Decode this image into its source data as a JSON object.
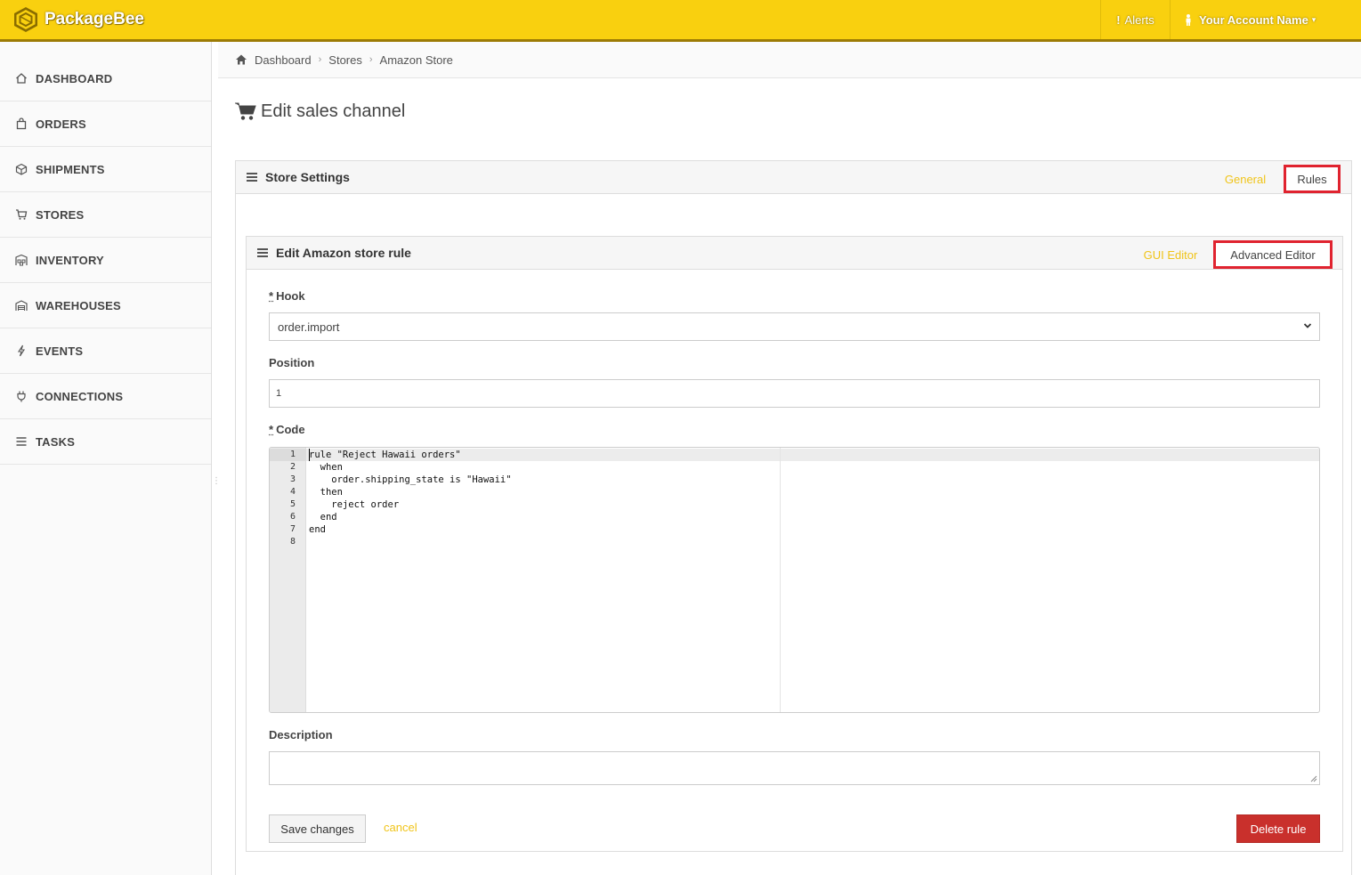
{
  "header": {
    "brand_name": "PackageBee",
    "alerts_label": "Alerts",
    "account_label": "Your Account Name"
  },
  "sidebar": {
    "items": [
      {
        "label": "DASHBOARD",
        "icon": "home-icon"
      },
      {
        "label": "ORDERS",
        "icon": "bag-icon"
      },
      {
        "label": "SHIPMENTS",
        "icon": "box-icon"
      },
      {
        "label": "STORES",
        "icon": "cart-icon"
      },
      {
        "label": "INVENTORY",
        "icon": "inventory-icon"
      },
      {
        "label": "WAREHOUSES",
        "icon": "warehouse-icon"
      },
      {
        "label": "EVENTS",
        "icon": "lightning-icon"
      },
      {
        "label": "CONNECTIONS",
        "icon": "plug-icon"
      },
      {
        "label": "TASKS",
        "icon": "list-icon"
      }
    ]
  },
  "breadcrumb": [
    "Dashboard",
    "Stores",
    "Amazon Store"
  ],
  "page_title": "Edit sales channel",
  "store_settings": {
    "title": "Store Settings",
    "tabs": {
      "general": "General",
      "rules": "Rules"
    }
  },
  "rule_panel": {
    "title": "Edit Amazon store rule",
    "tabs": {
      "gui": "GUI Editor",
      "advanced": "Advanced Editor"
    }
  },
  "form": {
    "hook_label": "Hook",
    "hook_required": "*",
    "hook_value": "order.import",
    "position_label": "Position",
    "position_value": "1",
    "code_label": "Code",
    "code_required": "*",
    "code_lines": [
      "rule \"Reject Hawaii orders\"",
      "  when",
      "    order.shipping_state is \"Hawaii\"",
      "  then",
      "    reject order",
      "  end",
      "end",
      ""
    ],
    "line_numbers": [
      "1",
      "2",
      "3",
      "4",
      "5",
      "6",
      "7",
      "8"
    ],
    "description_label": "Description",
    "save_label": "Save changes",
    "cancel_label": "cancel",
    "delete_label": "Delete rule"
  },
  "colors": {
    "brand_yellow": "#f9d00f",
    "link_yellow": "#f0c419",
    "highlight_red": "#e0232f",
    "danger_red": "#c9302c"
  }
}
